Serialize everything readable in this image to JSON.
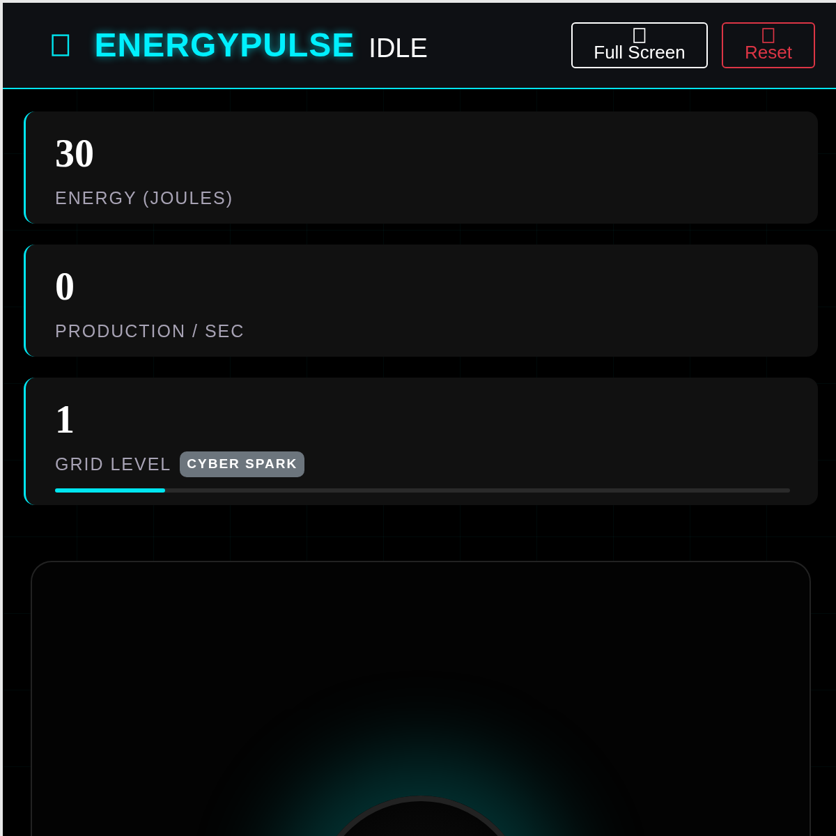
{
  "header": {
    "title": "ENERGYPULSE",
    "subtitle": "IDLE"
  },
  "buttons": [
    {
      "label": "Full Screen",
      "kind": "fullscreen"
    },
    {
      "label": "Reset",
      "kind": "danger"
    }
  ],
  "stats": [
    {
      "value": "30",
      "label": "ENERGY (JOULES)"
    },
    {
      "value": "0",
      "label": "PRODUCTION / SEC"
    },
    {
      "value": "1",
      "label": "GRID LEVEL",
      "badge": "CYBER SPARK",
      "level": 0.15
    }
  ]
}
